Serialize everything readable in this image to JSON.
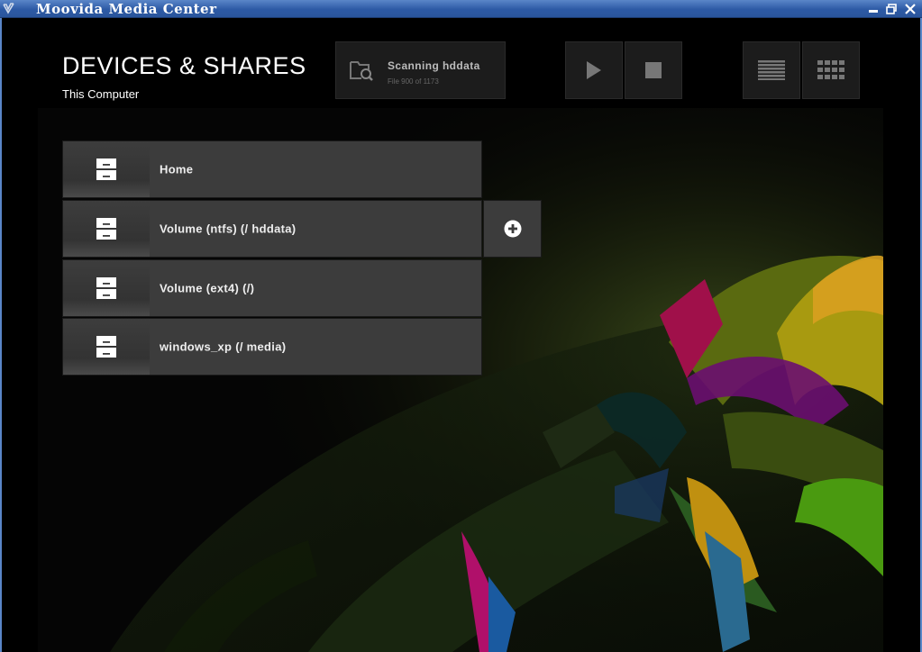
{
  "window": {
    "title": "Moovida Media Center",
    "icon": "app-icon",
    "controls": [
      "minimize-icon",
      "restore-icon",
      "close-icon"
    ]
  },
  "header": {
    "title": "DEVICES & SHARES",
    "subtitle": "This Computer"
  },
  "scan": {
    "icon": "folder-search-icon",
    "title": "Scanning  hddata",
    "detail": "File 900 of 1173"
  },
  "toolbar": {
    "playback": [
      "play-icon",
      "stop-icon"
    ],
    "view_modes": [
      "list-view-icon",
      "grid-view-icon"
    ]
  },
  "shares": [
    {
      "label": "Home",
      "icon": "drawer-icon"
    },
    {
      "label": "Volume (ntfs) (/ hddata)",
      "icon": "drawer-icon"
    },
    {
      "label": "Volume (ext4) (/)",
      "icon": "drawer-icon"
    },
    {
      "label": "windows_xp (/ media)",
      "icon": "drawer-icon"
    }
  ],
  "add_action": {
    "icon": "add-circle-icon"
  },
  "colors": {
    "titlebar": "#2d5aa5",
    "background": "#000000",
    "row_bg": "#3c3c3c",
    "text": "#ffffff"
  }
}
